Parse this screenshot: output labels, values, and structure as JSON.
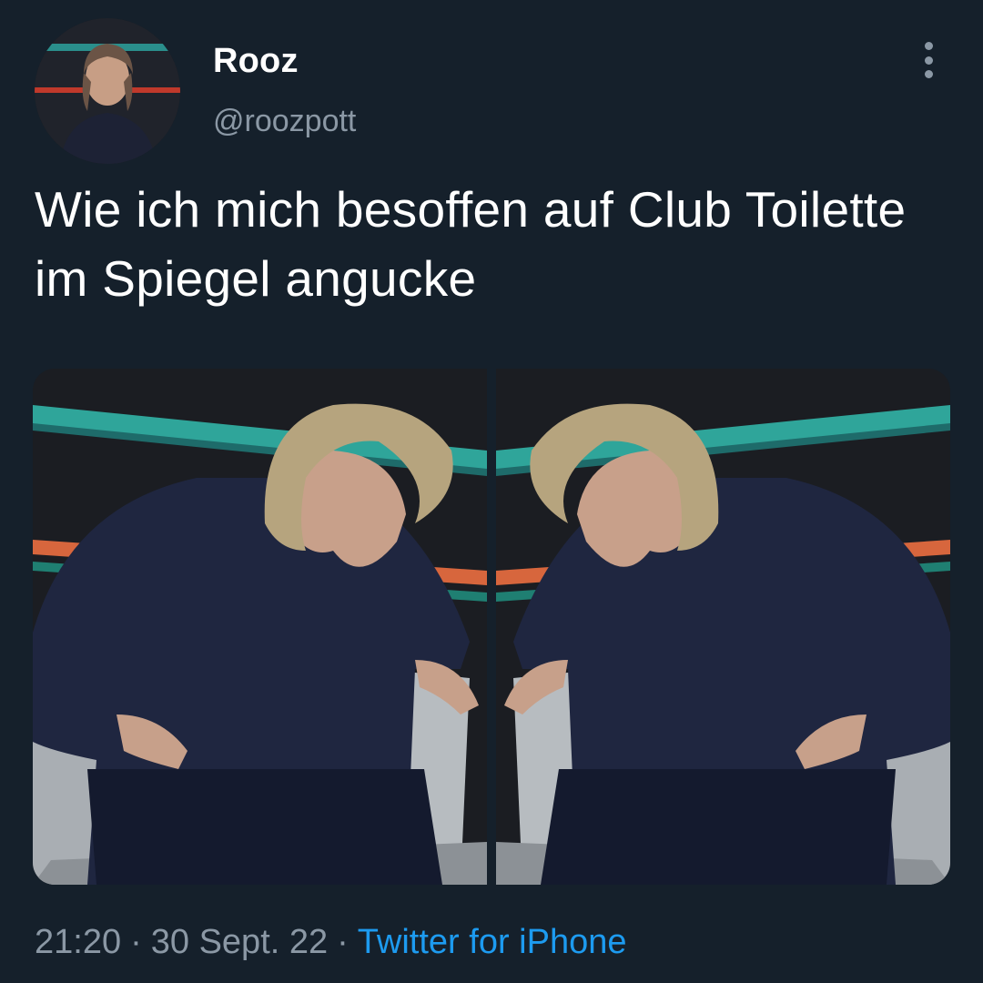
{
  "tweet": {
    "author": {
      "display_name": "Rooz",
      "handle": "@roozpott",
      "avatar_icon": "profile-photo"
    },
    "more_icon": "more-vertical-icon",
    "text": "Wie ich mich besoffen auf Club Toilette im Spiegel angucke",
    "media": [
      {
        "description_icon": "photo-man-seated"
      },
      {
        "description_icon": "photo-man-seated-mirrored"
      }
    ],
    "time": "21:20",
    "separator": "·",
    "date": "30 Sept. 22",
    "source": "Twitter for iPhone"
  },
  "colors": {
    "background": "#15202b",
    "secondary_text": "#8b98a5",
    "link": "#1d9bf0"
  }
}
